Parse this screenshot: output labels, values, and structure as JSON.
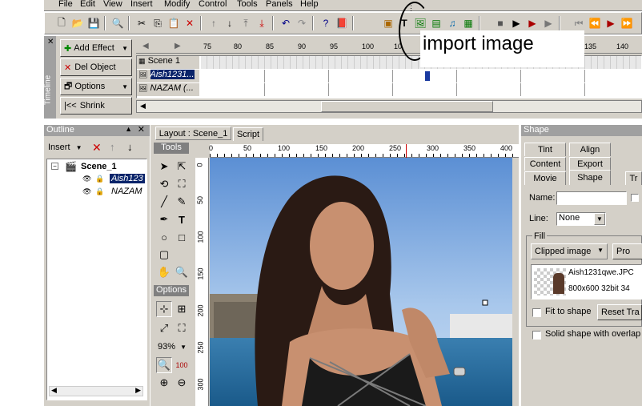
{
  "menu": [
    "File",
    "Edit",
    "View",
    "Insert",
    "Modify",
    "Control",
    "Tools",
    "Panels",
    "Help"
  ],
  "annotation": "import image",
  "timeline": {
    "side_label": "Timeline",
    "add_effect": "Add Effect",
    "del_object": "Del Object",
    "options": "Options",
    "shrink": "Shrink",
    "rows": [
      "Scene 1",
      "Aish1231...",
      "NAZAM (..."
    ],
    "ruler_ticks": [
      "75",
      "80",
      "85",
      "90",
      "95",
      "100",
      "10",
      "135",
      "140"
    ]
  },
  "outline": {
    "title": "Outline",
    "insert_label": "Insert",
    "tree": [
      "Scene_1",
      "Aish123",
      "NAZAM"
    ]
  },
  "stage": {
    "tabs": [
      "Layout : Scene_1",
      "Script"
    ],
    "tools_label": "Tools",
    "options_label": "Options",
    "zoom": "93%",
    "h_ticks": [
      "0",
      "50",
      "100",
      "150",
      "200",
      "250",
      "300",
      "350",
      "400"
    ],
    "v_ticks": [
      "0",
      "50",
      "100",
      "150",
      "200",
      "250",
      "300"
    ]
  },
  "shape_panel": {
    "title": "Shape",
    "tabs_row1": [
      "Tint",
      "Align"
    ],
    "tabs_row2": [
      "Content",
      "Export"
    ],
    "tabs_row3": [
      "Movie",
      "Shape",
      "Tr"
    ],
    "name_label": "Name:",
    "line_label": "Line:",
    "line_value": "None",
    "fill_label": "Fill",
    "fill_value": "Clipped image",
    "pro_button": "Pro",
    "image_name": "Aish1231qwe.JPC",
    "image_info": "800x600 32bit 34",
    "fit_to_shape": "Fit to shape",
    "reset_button": "Reset Tra",
    "solid_shape": "Solid shape with overlap"
  }
}
